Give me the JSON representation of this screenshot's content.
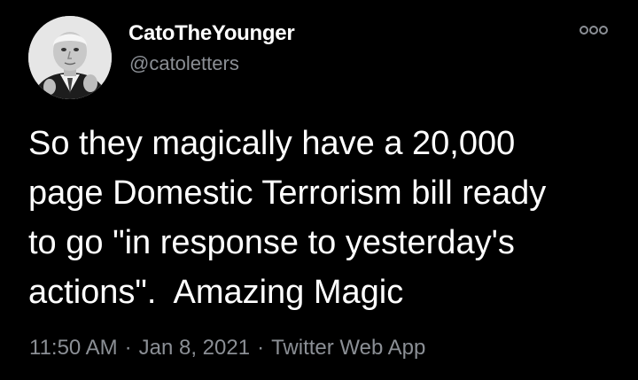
{
  "author": {
    "display_name": "CatoTheYounger",
    "handle": "@catoletters"
  },
  "icons": {
    "more": "more-options-icon"
  },
  "tweet": {
    "text": "So they magically have a 20,000\npage Domestic Terrorism bill ready\nto go \"in response to yesterday's\nactions\".  Amazing Magic"
  },
  "meta": {
    "time": "11:50 AM",
    "separator": "·",
    "date": "Jan 8, 2021",
    "source": "Twitter Web App"
  },
  "colors": {
    "background": "#000000",
    "primary_text": "#ffffff",
    "secondary_text": "#8b8f95"
  }
}
